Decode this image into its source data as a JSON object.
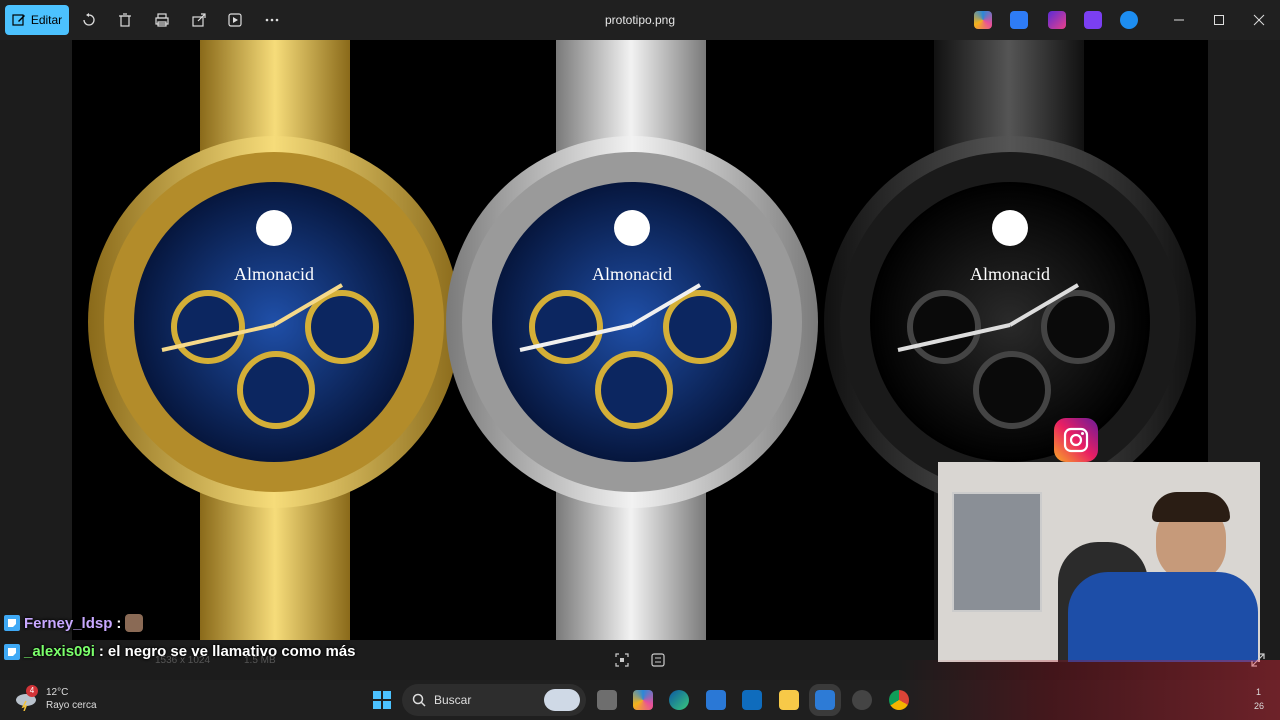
{
  "toolbar": {
    "edit_label": "Editar",
    "file_name": "prototipo.png"
  },
  "image": {
    "brand": "Almonacid",
    "watches": [
      {
        "name": "gold",
        "case": "#d4af37",
        "dial": "#0d2a6b",
        "hand": "#f5d98a"
      },
      {
        "name": "silver",
        "case": "#c8c8c8",
        "dial": "#0d2a6b",
        "hand": "#f0f0f0"
      },
      {
        "name": "black",
        "case": "#2a2a2a",
        "dial": "#080808",
        "hand": "#dddddd"
      }
    ]
  },
  "status": {
    "dimensions": "1536 x 1024",
    "size": "1.5 MB"
  },
  "chat": [
    {
      "user": "Ferney_ldsp",
      "sep": ":",
      "message": "",
      "color": "#c8a8ff"
    },
    {
      "user": "_alexis09i",
      "sep": ":",
      "message": "el negro se ve llamativo como más",
      "color": "#7bff6b"
    }
  ],
  "taskbar": {
    "temp": "12°C",
    "weather": "Rayo cerca",
    "weather_badge": "4",
    "search_placeholder": "Buscar",
    "clock_fragment_1": "1",
    "clock_fragment_2": "26"
  },
  "colors": {
    "accent": "#4cc2ff",
    "titlebar": "#202020",
    "taskbar": "#1f1f1f"
  }
}
